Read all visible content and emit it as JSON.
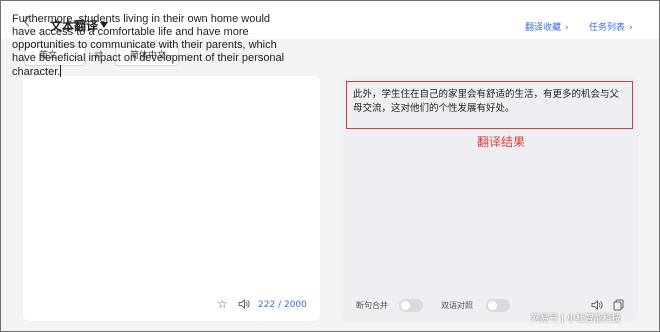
{
  "header": {
    "title": "文本翻译",
    "favorites_link": "翻译收藏",
    "tasks_link": "任务列表"
  },
  "language_bar": {
    "source_lang": "英文",
    "target_lang": "简体中文"
  },
  "source": {
    "text": "Furthermore, students living in their own home would have access to a comfortable life and have more opportunities to communicate with their parents, which have beneficial impact on development of their personal character.",
    "char_count": "222",
    "char_max": "2000"
  },
  "target": {
    "text": "此外，学生住在自己的家里会有舒适的生活，有更多的机会与父母交流，这对他们的个性发展有好处。",
    "annotation": "翻译结果",
    "toggle_merge_label": "断句合并",
    "toggle_bilingual_label": "双语对照"
  },
  "watermark": {
    "text": "网易号 | 小杜智能科技"
  }
}
